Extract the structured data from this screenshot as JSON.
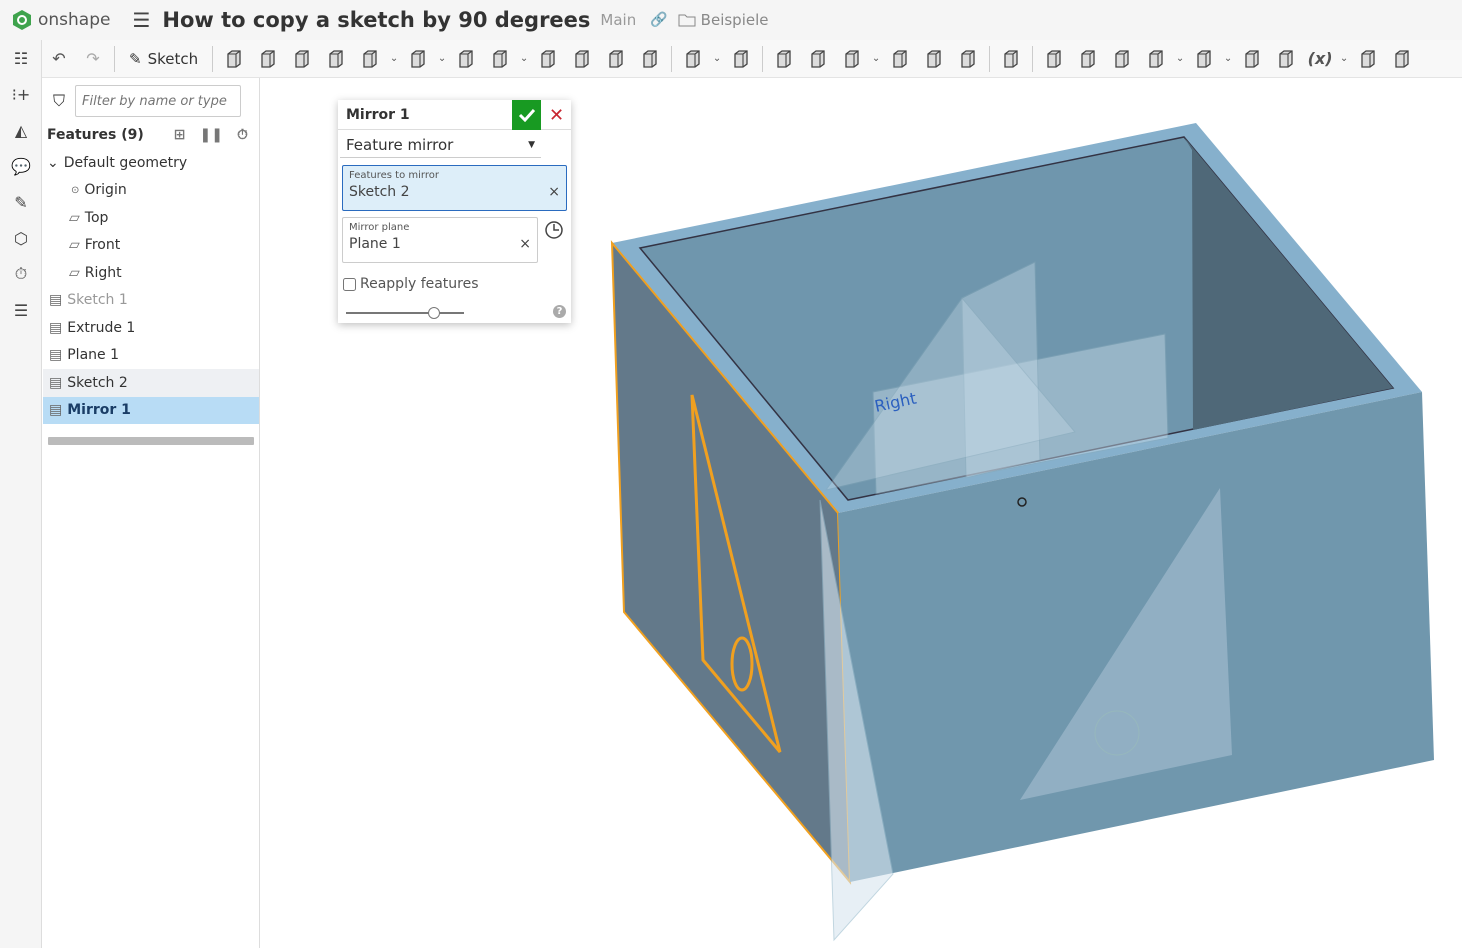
{
  "app": {
    "name": "onshape",
    "title": "How to copy a sketch by 90 degrees",
    "branch": "Main",
    "folder": "Beispiele"
  },
  "toolbar": {
    "sketch_label": "Sketch",
    "variable_label": "(x)",
    "tools": [
      "extrude",
      "revolve",
      "sweep",
      "loft",
      "thicken",
      "fillet",
      "chamfer",
      "draft",
      "rib",
      "shell",
      "hole",
      "cylinder",
      "pattern",
      "mirror",
      "boolean",
      "split",
      "transform",
      "delete-part",
      "modify-fillet",
      "delete-face",
      "move-face",
      "replace-face",
      "plane",
      "helix-surface",
      "sheet-metal",
      "mate-connector",
      "measure",
      "derive",
      "variable",
      "assembly",
      "tag"
    ]
  },
  "features": {
    "filter_placeholder": "Filter by name or type",
    "header": "Features (9)",
    "default_geometry": "Default geometry",
    "items": [
      {
        "label": "Origin"
      },
      {
        "label": "Top"
      },
      {
        "label": "Front"
      },
      {
        "label": "Right"
      }
    ],
    "list": [
      {
        "label": "Sketch 1",
        "state": "suppressed"
      },
      {
        "label": "Extrude 1"
      },
      {
        "label": "Plane 1"
      },
      {
        "label": "Sketch 2",
        "state": "hover"
      },
      {
        "label": "Mirror 1",
        "state": "selected"
      }
    ]
  },
  "dialog": {
    "title": "Mirror 1",
    "type": "Feature mirror",
    "features_label": "Features to mirror",
    "features_value": "Sketch 2",
    "plane_label": "Mirror plane",
    "plane_value": "Plane 1",
    "reapply": "Reapply features",
    "reapply_checked": false,
    "help": "?"
  },
  "viewport": {
    "plane_label": "Right",
    "colors": {
      "body": "#6f96ad",
      "highlight": "#f0a020",
      "ok": "#189a22"
    }
  }
}
